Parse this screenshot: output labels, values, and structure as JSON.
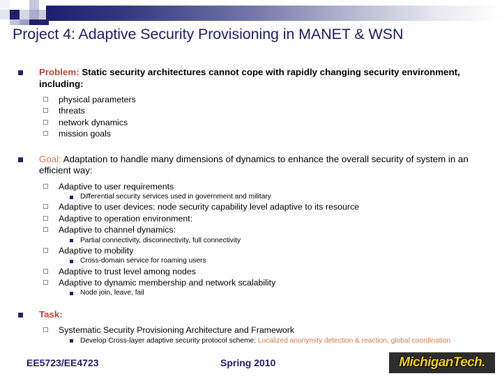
{
  "slide": {
    "title": "Project 4: Adaptive Security Provisioning in MANET & WSN",
    "sections": {
      "problem": {
        "lead": "Problem:",
        "text": " Static security architectures cannot cope with rapidly changing security environment, including:",
        "items": [
          "physical parameters",
          "threats",
          "network dynamics",
          "mission goals"
        ]
      },
      "goal": {
        "lead": "Goal:",
        "text": " Adaptation to handle many dimensions of dynamics to enhance the overall security of system in an efficient way:",
        "items": [
          "Adaptive to user requirements",
          "Differential security services used in government and military",
          "Adaptive to user devices: node security capability level adaptive to its resource",
          "Adaptive to operation environment:",
          "Adaptive to channel dynamics:",
          "Partial connectivity, disconnectivity, full connectivity",
          "Adaptive to mobility",
          "Cross-domain service for roaming users",
          "Adaptive to trust level among nodes",
          "Adaptive to dynamic membership and network scalability",
          "Node join, leave, fail"
        ]
      },
      "task": {
        "lead": "Task:",
        "text": "",
        "item_l2": "Systematic Security Provisioning Architecture and Framework",
        "item_l3_plain": "Develop Cross-layer adaptive security protocol scheme: ",
        "item_l3_accent": "Localized anonymity detection & reaction, global coordination"
      }
    }
  },
  "footer": {
    "course": "EE5723/EE4723",
    "term": "Spring 2010",
    "logo_text": "MichiganTech."
  },
  "colors": {
    "title_navy": "#1b1b63",
    "accent_orange": "#c0473b",
    "accent_light_orange": "#d2764f",
    "bullet_navy": "#23236b",
    "logo_gold": "#f5d316"
  }
}
